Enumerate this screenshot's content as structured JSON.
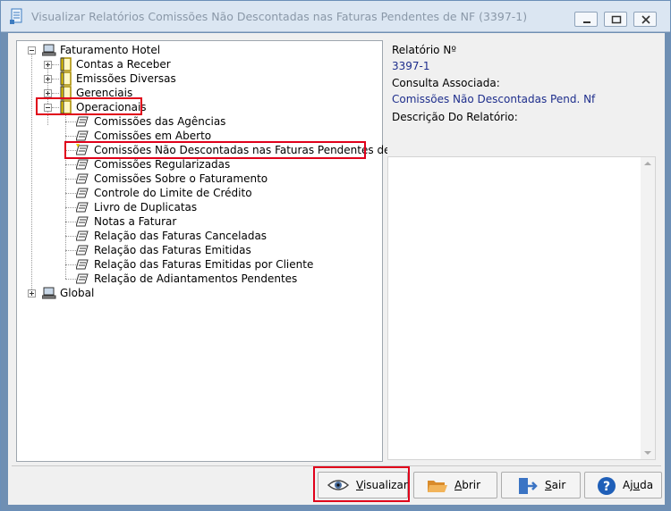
{
  "window": {
    "title": "Visualizar Relatórios Comissões Não Descontadas nas Faturas Pendentes de NF (3397-1)"
  },
  "tree": {
    "root1": "Faturamento Hotel",
    "groups": [
      "Contas a Receber",
      "Emissões Diversas",
      "Gerenciais",
      "Operacionais"
    ],
    "reports": [
      "Comissões das Agências",
      "Comissões em Aberto",
      "Comissões Não Descontadas nas Faturas Pendentes de NF",
      "Comissões Regularizadas",
      "Comissões Sobre o Faturamento",
      "Controle do Limite de Crédito",
      "Livro de Duplicatas",
      "Notas a Faturar",
      "Relação das Faturas Canceladas",
      "Relação das Faturas Emitidas",
      "Relação das Faturas Emitidas por Cliente",
      "Relação de Adiantamentos Pendentes"
    ],
    "root2": "Global"
  },
  "info": {
    "report_no_label": "Relatório Nº",
    "report_no_value": "3397-1",
    "query_label": "Consulta Associada:",
    "query_value": "Comissões Não Descontadas Pend. Nf",
    "description_label": "Descrição Do Relatório:"
  },
  "buttons": {
    "visualizar": {
      "first": "V",
      "rest": "isualizar"
    },
    "abrir": {
      "first": "A",
      "rest": "brir"
    },
    "sair": {
      "first": "S",
      "rest": "air"
    },
    "ajuda": {
      "pre": "Aj",
      "u": "u",
      "post": "da"
    }
  },
  "colors": {
    "highlight_border": "#e0001a",
    "info_value": "#1e2e8c",
    "title_text": "#8a98a8"
  }
}
